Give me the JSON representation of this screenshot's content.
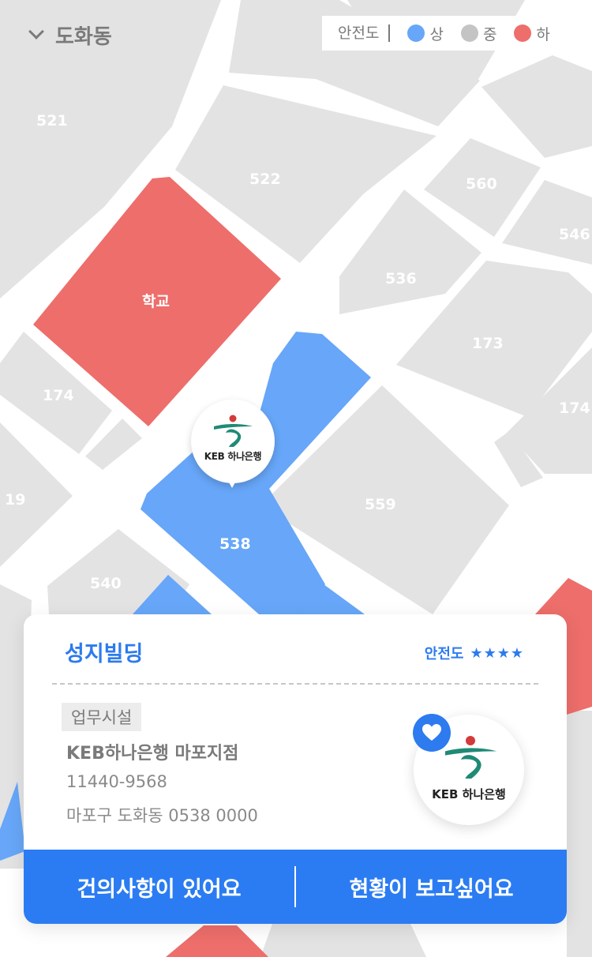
{
  "header": {
    "location": "도화동"
  },
  "legend": {
    "title": "안전도",
    "items": [
      {
        "label": "상",
        "color": "#67a6f8"
      },
      {
        "label": "중",
        "color": "#c4c4c4"
      },
      {
        "label": "하",
        "color": "#ee6e6b"
      }
    ]
  },
  "map": {
    "road_color": "#ffffff",
    "block_color": "#e3e3e3",
    "labels": {
      "b521": "521",
      "b522": "522",
      "b560": "560",
      "b546": "546",
      "b536": "536",
      "school": "학교",
      "b173": "173",
      "b174a": "174",
      "b174b": "174",
      "b19": "19",
      "b559": "559",
      "b538": "538",
      "b540": "540"
    },
    "marker": {
      "logo_text": "KEB 하나은행",
      "icon": "keb-hana-logo-icon"
    }
  },
  "card": {
    "building_name": "성지빌딩",
    "safety_label": "안전도",
    "safety_stars": "★★★★",
    "safety_rating": 4,
    "category": "업무시설",
    "business_name": "KEB하나은행 마포지점",
    "code": "11440-9568",
    "address": "마포구 도화동 0538 0000",
    "logo_text": "KEB 하나은행",
    "favorite_icon": "heart-icon",
    "buttons": {
      "left": "건의사항이 있어요",
      "right": "현황이 보고싶어요"
    }
  }
}
